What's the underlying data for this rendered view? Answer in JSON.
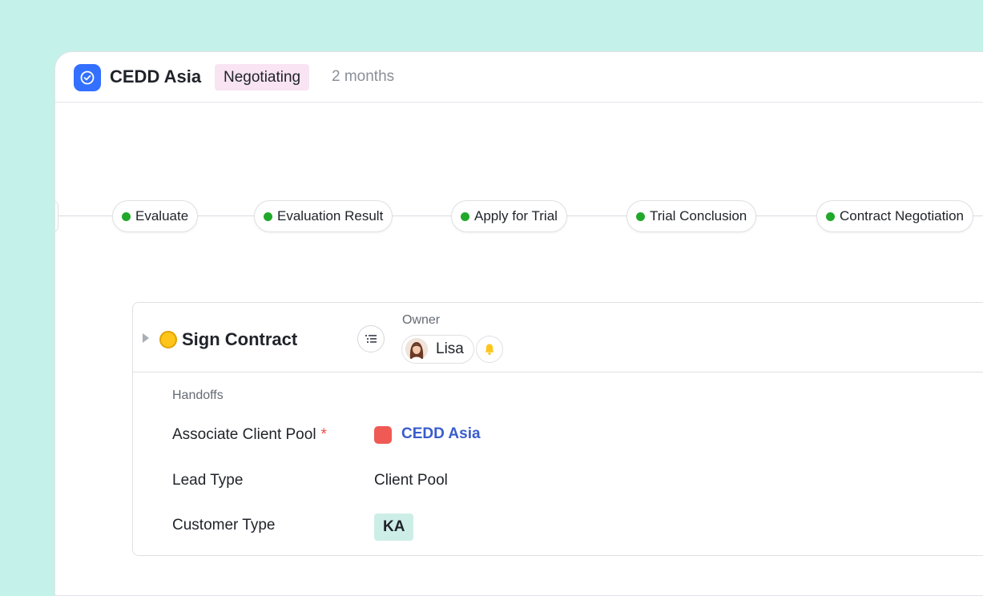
{
  "header": {
    "title": "CEDD Asia",
    "stage_badge": "Negotiating",
    "duration": "2 months",
    "app_icon": "check-circle-icon",
    "colors": {
      "accent": "#3370ff",
      "badge_bg": "#f8e4f3"
    }
  },
  "pipeline": {
    "stages": [
      {
        "label": "Evaluate",
        "status_color": "#20a82a"
      },
      {
        "label": "Evaluation Result",
        "status_color": "#20a82a"
      },
      {
        "label": "Apply for Trial",
        "status_color": "#20a82a"
      },
      {
        "label": "Trial Conclusion",
        "status_color": "#20a82a"
      },
      {
        "label": "Contract Negotiation",
        "status_color": "#20a82a"
      }
    ]
  },
  "task": {
    "title": "Sign Contract",
    "status_color": "#ffc51a",
    "owner_label": "Owner",
    "owner_name": "Lisa",
    "list_icon": "list-icon",
    "bell_icon": "bell-icon",
    "handoffs": {
      "section_title": "Handoffs",
      "fields": [
        {
          "label": "Associate Client Pool",
          "required": "*",
          "value": "CEDD Asia",
          "swatch_color": "#f05a55"
        },
        {
          "label": "Lead Type",
          "value": "Client Pool"
        },
        {
          "label": "Customer Type",
          "value": "KA"
        }
      ]
    }
  }
}
